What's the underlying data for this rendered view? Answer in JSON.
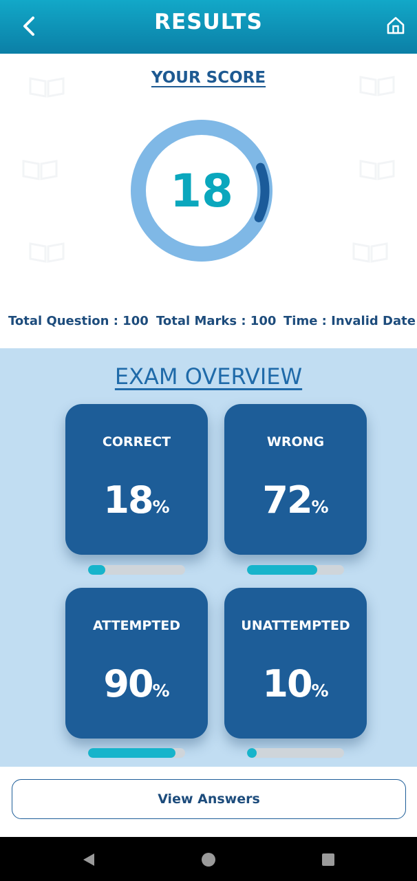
{
  "header": {
    "title": "RESULTS",
    "back_icon": "chevron-left-icon",
    "home_icon": "home-icon"
  },
  "score": {
    "heading": "YOUR SCORE",
    "value": "18",
    "ring_progress": 0.18,
    "colors": {
      "ring_track": "#7fb8e6",
      "ring_progress": "#1b5b9a",
      "value": "#0aa7bd"
    }
  },
  "stats": {
    "total_question": "Total Question : 100",
    "total_marks": "Total Marks : 100",
    "time": "Time : Invalid Date"
  },
  "overview": {
    "title": "EXAM OVERVIEW",
    "cards": [
      {
        "label": "CORRECT",
        "value": "18",
        "unit": "%",
        "progress": 0.18
      },
      {
        "label": "WRONG",
        "value": "72",
        "unit": "%",
        "progress": 0.72
      },
      {
        "label": "ATTEMPTED",
        "value": "90",
        "unit": "%",
        "progress": 0.9
      },
      {
        "label": "UNATTEMPTED",
        "value": "10",
        "unit": "%",
        "progress": 0.1
      }
    ],
    "colors": {
      "card": "#1d5d98",
      "bar_track": "#cfd5da",
      "bar_fill": "#17b4cb",
      "background": "#c1ddf2"
    }
  },
  "actions": {
    "view_answers": "View Answers"
  },
  "system_nav": {
    "back_icon": "triangle-back-icon",
    "home_icon": "circle-home-icon",
    "recent_icon": "square-recents-icon"
  }
}
